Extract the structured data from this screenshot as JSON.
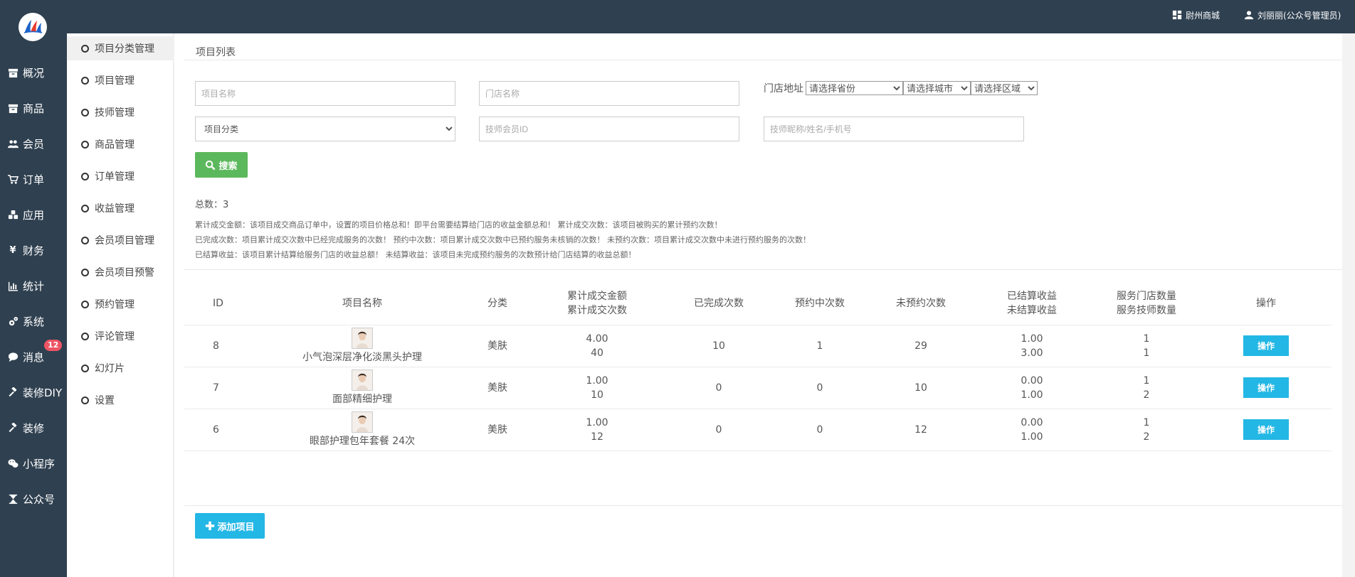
{
  "nav": {
    "items": [
      {
        "label": "概况",
        "icon": "archive-icon"
      },
      {
        "label": "商品",
        "icon": "archive-icon"
      },
      {
        "label": "会员",
        "icon": "users-icon"
      },
      {
        "label": "订单",
        "icon": "cart-icon"
      },
      {
        "label": "应用",
        "icon": "cubes-icon"
      },
      {
        "label": "财务",
        "icon": "yen-icon"
      },
      {
        "label": "统计",
        "icon": "bar-chart-icon"
      },
      {
        "label": "系统",
        "icon": "cogs-icon"
      },
      {
        "label": "消息",
        "icon": "comment-icon",
        "badge": "12"
      },
      {
        "label": "装修DIY",
        "icon": "gavel-icon"
      },
      {
        "label": "装修",
        "icon": "gavel-icon"
      },
      {
        "label": "小程序",
        "icon": "wechat-icon"
      },
      {
        "label": "公众号",
        "icon": "hourglass-icon"
      }
    ]
  },
  "topbar": {
    "shop_label": "尉州商城",
    "user_label": "刘丽丽(公众号管理员)"
  },
  "submenu": {
    "items": [
      "项目分类管理",
      "项目管理",
      "技师管理",
      "商品管理",
      "订单管理",
      "收益管理",
      "会员项目管理",
      "会员项目预警",
      "预约管理",
      "评论管理",
      "幻灯片",
      "设置"
    ],
    "active_index": 0
  },
  "page": {
    "title": "项目列表",
    "filters": {
      "project_name_placeholder": "项目名称",
      "store_name_placeholder": "门店名称",
      "address_label": "门店地址",
      "province_selected": "请选择省份",
      "city_selected": "请选择城市",
      "district_selected": "请选择区域",
      "category_selected": "项目分类",
      "tech_id_placeholder": "技师会员ID",
      "tech_info_placeholder": "技师昵称/姓名/手机号"
    },
    "search_label": "搜索",
    "total_label": "总数：",
    "total_value": "3",
    "notes": [
      "累计成交金额：该项目成交商品订单中，设置的项目价格总和！即平台需要结算给门店的收益金额总和！   累计成交次数：该项目被购买的累计预约次数！",
      "已完成次数：项目累计成交次数中已经完成服务的次数！   预约中次数：项目累计成交次数中已预约服务未核销的次数！   未预约次数：项目累计成交次数中未进行预约服务的次数！",
      "已结算收益：该项目累计结算给服务门店的收益总额！   未结算收益：该项目未完成预约服务的次数预计给门店结算的收益总额！"
    ],
    "table": {
      "headers": {
        "id": "ID",
        "name": "项目名称",
        "category": "分类",
        "amount": "累计成交金额",
        "count": "累计成交次数",
        "done": "已完成次数",
        "booking": "预约中次数",
        "unbooked": "未预约次数",
        "settled": "已结算收益",
        "unsettled": "未结算收益",
        "stores": "服务门店数量",
        "techs": "服务技师数量",
        "op": "操作"
      },
      "rows": [
        {
          "id": "8",
          "name": "小气泡深层净化淡黑头护理",
          "category": "美肤",
          "amount": "4.00",
          "count": "40",
          "done": "10",
          "booking": "1",
          "unbooked": "29",
          "settled": "1.00",
          "unsettled": "3.00",
          "stores": "1",
          "techs": "1",
          "op": "操作"
        },
        {
          "id": "7",
          "name": "面部精细护理",
          "category": "美肤",
          "amount": "1.00",
          "count": "10",
          "done": "0",
          "booking": "0",
          "unbooked": "10",
          "settled": "0.00",
          "unsettled": "1.00",
          "stores": "1",
          "techs": "2",
          "op": "操作"
        },
        {
          "id": "6",
          "name": "眼部护理包年套餐 24次",
          "category": "美肤",
          "amount": "1.00",
          "count": "12",
          "done": "0",
          "booking": "0",
          "unbooked": "12",
          "settled": "0.00",
          "unsettled": "1.00",
          "stores": "1",
          "techs": "2",
          "op": "操作"
        }
      ]
    },
    "add_label": "添加项目"
  },
  "colors": {
    "sidebar_bg": "#2f4050",
    "search_green": "#5cb85c",
    "action_blue": "#23b7e5",
    "badge_red": "#ed5565"
  }
}
